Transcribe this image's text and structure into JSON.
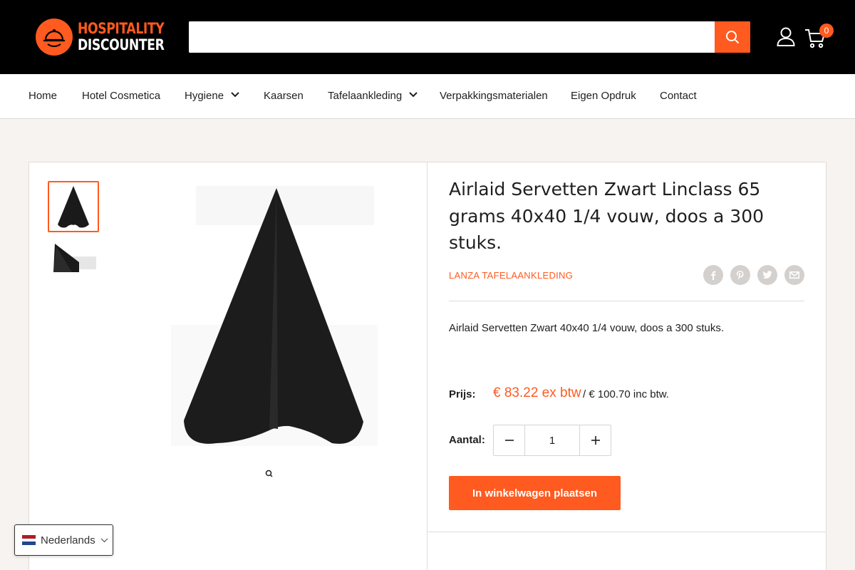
{
  "header": {
    "logo_line1": "HOSPITALITY",
    "logo_line2": "DISCOUNTER",
    "search_placeholder": "",
    "cart_count": "0",
    "icons": {
      "search": "search-icon",
      "account": "user-icon",
      "cart": "cart-icon"
    }
  },
  "nav": {
    "items": [
      {
        "label": "Home",
        "dropdown": false
      },
      {
        "label": "Hotel Cosmetica",
        "dropdown": false
      },
      {
        "label": "Hygiene",
        "dropdown": true
      },
      {
        "label": "Kaarsen",
        "dropdown": false
      },
      {
        "label": "Tafelaankleding",
        "dropdown": true
      },
      {
        "label": "Verpakkingsmaterialen",
        "dropdown": false
      },
      {
        "label": "Eigen Opdruk",
        "dropdown": false
      },
      {
        "label": "Contact",
        "dropdown": false
      }
    ]
  },
  "product": {
    "title": "Airlaid Servetten Zwart Linclass 65 grams 40x40 1/4 vouw, doos a 300 stuks.",
    "brand": "LANZA TAFELAANKLEDING",
    "description": "Airlaid Servetten Zwart 40x40 1/4 vouw, doos a 300 stuks.",
    "price_label": "Prijs:",
    "price_ex": "€ 83.22 ex btw",
    "price_inc": "/ € 100.70 inc btw.",
    "quantity_label": "Aantal:",
    "quantity_value": "1",
    "add_to_cart": "In winkelwagen plaatsen",
    "share_icons": [
      "facebook-icon",
      "pinterest-icon",
      "twitter-icon",
      "email-icon"
    ]
  },
  "language": {
    "label": "Nederlands"
  },
  "colors": {
    "accent": "#ff5a1f",
    "header_bg": "#000000",
    "page_bg": "#f6f3f0"
  }
}
